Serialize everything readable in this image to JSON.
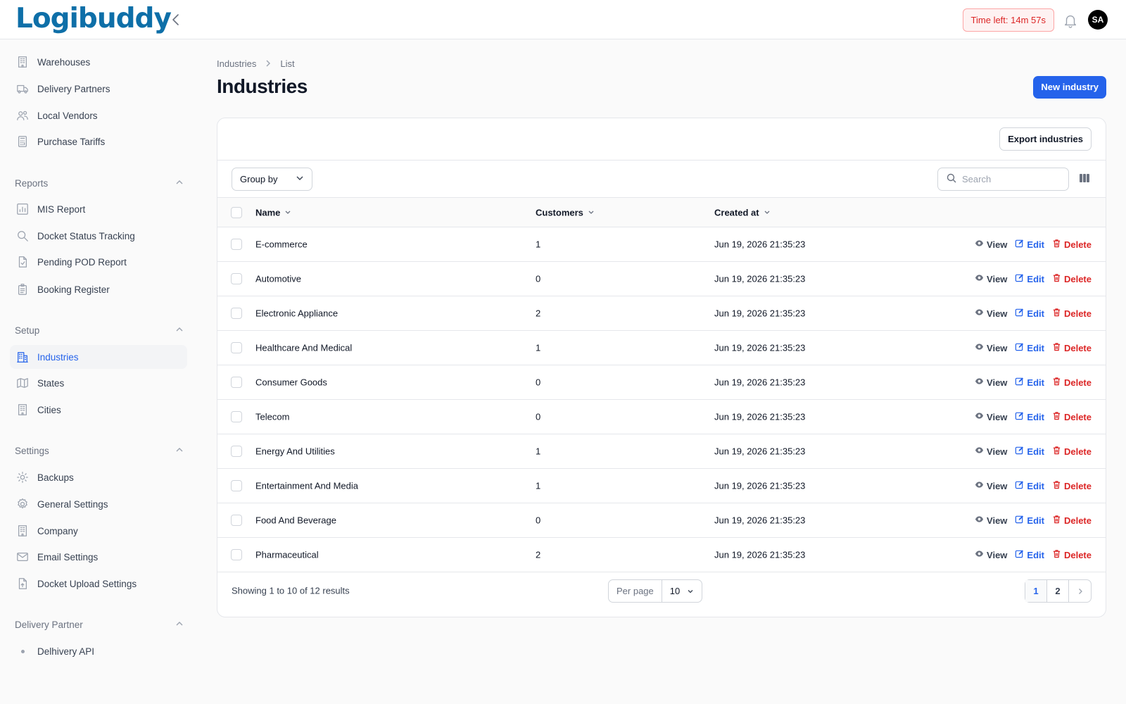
{
  "app": {
    "logo_text": "Logibuddy",
    "timer": "Time left: 14m 57s",
    "avatar_initials": "SA"
  },
  "sidebar": {
    "items_top": [
      {
        "label": "Warehouses",
        "icon": "building-icon"
      },
      {
        "label": "Delivery Partners",
        "icon": "truck-icon"
      },
      {
        "label": "Local Vendors",
        "icon": "users-icon"
      },
      {
        "label": "Purchase Tariffs",
        "icon": "calculator-icon"
      }
    ],
    "reports_label": "Reports",
    "reports": [
      {
        "label": "MIS Report",
        "icon": "chart-icon"
      },
      {
        "label": "Docket Status Tracking",
        "icon": "search-icon"
      },
      {
        "label": "Pending POD Report",
        "icon": "document-check-icon"
      },
      {
        "label": "Booking Register",
        "icon": "clipboard-icon"
      }
    ],
    "setup_label": "Setup",
    "setup": [
      {
        "label": "Industries",
        "icon": "building-office-icon"
      },
      {
        "label": "States",
        "icon": "map-icon"
      },
      {
        "label": "Cities",
        "icon": "building-icon"
      }
    ],
    "settings_label": "Settings",
    "settings": [
      {
        "label": "Backups",
        "icon": "cog-icon"
      },
      {
        "label": "General Settings",
        "icon": "gear-icon"
      },
      {
        "label": "Company",
        "icon": "building-icon"
      },
      {
        "label": "Email Settings",
        "icon": "envelope-icon"
      },
      {
        "label": "Docket Upload Settings",
        "icon": "document-upload-icon"
      }
    ],
    "delivery_partner_label": "Delivery Partner",
    "delivery_partner": [
      {
        "label": "Delhivery API"
      }
    ]
  },
  "breadcrumb": {
    "parent": "Industries",
    "current": "List"
  },
  "page": {
    "title": "Industries",
    "new_button": "New industry",
    "export_button": "Export industries"
  },
  "toolbar": {
    "group_by": "Group by",
    "search_placeholder": "Search"
  },
  "table": {
    "headers": {
      "name": "Name",
      "customers": "Customers",
      "created_at": "Created at"
    },
    "actions": {
      "view": "View",
      "edit": "Edit",
      "delete": "Delete"
    },
    "rows": [
      {
        "name": "E-commerce",
        "customers": "1",
        "created_at": "Jun 19, 2026 21:35:23"
      },
      {
        "name": "Automotive",
        "customers": "0",
        "created_at": "Jun 19, 2026 21:35:23"
      },
      {
        "name": "Electronic Appliance",
        "customers": "2",
        "created_at": "Jun 19, 2026 21:35:23"
      },
      {
        "name": "Healthcare And Medical",
        "customers": "1",
        "created_at": "Jun 19, 2026 21:35:23"
      },
      {
        "name": "Consumer Goods",
        "customers": "0",
        "created_at": "Jun 19, 2026 21:35:23"
      },
      {
        "name": "Telecom",
        "customers": "0",
        "created_at": "Jun 19, 2026 21:35:23"
      },
      {
        "name": "Energy And Utilities",
        "customers": "1",
        "created_at": "Jun 19, 2026 21:35:23"
      },
      {
        "name": "Entertainment And Media",
        "customers": "1",
        "created_at": "Jun 19, 2026 21:35:23"
      },
      {
        "name": "Food And Beverage",
        "customers": "0",
        "created_at": "Jun 19, 2026 21:35:23"
      },
      {
        "name": "Pharmaceutical",
        "customers": "2",
        "created_at": "Jun 19, 2026 21:35:23"
      }
    ]
  },
  "footer": {
    "showing": "Showing 1 to 10 of 12 results",
    "per_page_label": "Per page",
    "per_page_value": "10",
    "pages": [
      "1",
      "2"
    ],
    "current_page": "1"
  },
  "colors": {
    "primary": "#2563eb",
    "danger": "#dc2626",
    "logo": "#0e6fa8"
  }
}
